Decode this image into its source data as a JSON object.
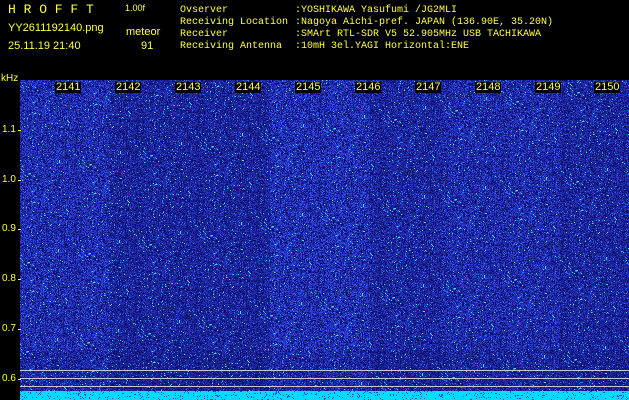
{
  "header": {
    "app_name": "H R O F F T",
    "version": "1.00f",
    "filename": "YY2611192140.png",
    "datetime": "25.11.19 21:40",
    "meteor_label": "meteor",
    "meteor_count": "91",
    "info_labels": [
      "Ovserver",
      "Receiving Location",
      "Receiver",
      "Receiving Antenna"
    ],
    "info_values": [
      ":YOSHIKAWA Yasufumi /JG2MLI",
      ":Nagoya Aichi-pref. JAPAN (136.90E, 35.20N)",
      ":SMArt RTL-SDR V5 52.905MHz USB TACHIKAWA",
      ":10mH 3el.YAGI Horizontal:ENE"
    ]
  },
  "axes": {
    "y_unit": "kHz",
    "y_ticks": [
      "1.1",
      "1.0",
      "0.9",
      "0.8",
      "0.7",
      "0.6"
    ],
    "x_ticks": [
      "2141",
      "2142",
      "2143",
      "2144",
      "2145",
      "2146",
      "2147",
      "2148",
      "2149",
      "2150"
    ]
  },
  "colors": {
    "text": "#ffff40",
    "background_low": "#0a0a6e",
    "background_high": "#3c50ff",
    "noise_speck": "#40e0ff",
    "bottom_band": "#00e0ff",
    "guide_line": "#c8c8c8"
  }
}
